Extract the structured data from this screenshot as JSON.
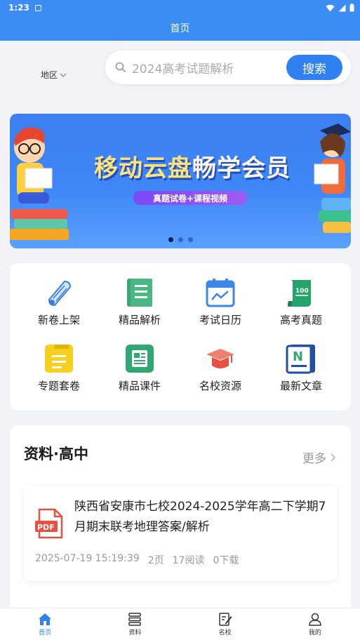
{
  "status_bar": {
    "time": "1:23"
  },
  "app_bar": {
    "title": "首页"
  },
  "region": {
    "label": "地区"
  },
  "search": {
    "placeholder": "2024高考试题解析",
    "button_label": "搜索"
  },
  "banner": {
    "title_prefix": "移动云盘",
    "title_suffix": "畅学会员",
    "subtitle": "真题试卷+课程视频",
    "page_count": 3,
    "active_index": 0
  },
  "categories": [
    {
      "label": "新卷上架",
      "icon": "scroll-icon"
    },
    {
      "label": "精品解析",
      "icon": "notebook-icon"
    },
    {
      "label": "考试日历",
      "icon": "calendar-icon"
    },
    {
      "label": "高考真题",
      "icon": "exam-paper-icon"
    },
    {
      "label": "专题套卷",
      "icon": "note-icon"
    },
    {
      "label": "精品课件",
      "icon": "newspaper-icon"
    },
    {
      "label": "名校资源",
      "icon": "graduation-cap-icon"
    },
    {
      "label": "最新文章",
      "icon": "article-icon"
    }
  ],
  "section": {
    "title": "资料·高中",
    "more_label": "更多",
    "items": [
      {
        "title": "陕西省安康市七校2024-2025学年高二下学期7月期末联考地理答案/解析",
        "datetime": "2025-07-19 15:19:39",
        "pages": "2页",
        "reads": "17阅读",
        "downloads": "0下载"
      }
    ]
  },
  "tabs": [
    {
      "label": "首页",
      "icon": "home-icon"
    },
    {
      "label": "资料",
      "icon": "stack-icon"
    },
    {
      "label": "名校",
      "icon": "edit-doc-icon"
    },
    {
      "label": "我的",
      "icon": "user-icon"
    }
  ],
  "colors": {
    "primary": "#3b8cf5",
    "button": "#2f80f0",
    "page_bg": "#f2f3f7"
  }
}
